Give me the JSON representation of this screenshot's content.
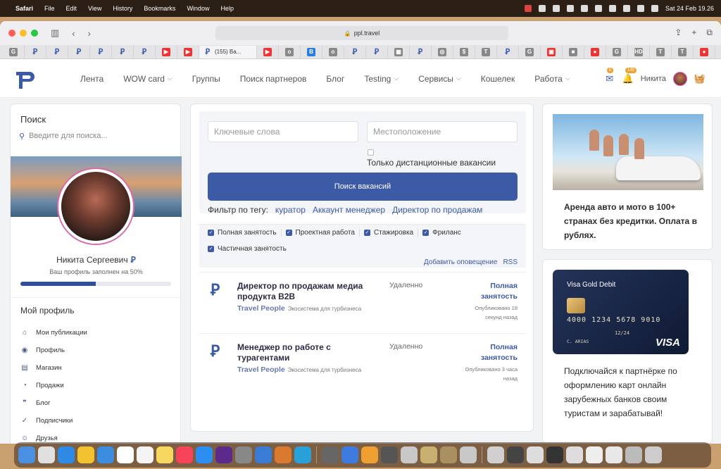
{
  "menubar": {
    "app": "Safari",
    "items": [
      "File",
      "Edit",
      "View",
      "History",
      "Bookmarks",
      "Window",
      "Help"
    ],
    "datetime": "Sat 24 Feb  19.26"
  },
  "browser": {
    "url": "ppl.travel",
    "active_tab": "(155) Ва..."
  },
  "site": {
    "nav": [
      {
        "label": "Лента",
        "dropdown": false
      },
      {
        "label": "WOW card",
        "dropdown": true
      },
      {
        "label": "Группы",
        "dropdown": false
      },
      {
        "label": "Поиск партнеров",
        "dropdown": false
      },
      {
        "label": "Блог",
        "dropdown": false
      },
      {
        "label": "Testing",
        "dropdown": true
      },
      {
        "label": "Сервисы",
        "dropdown": true
      },
      {
        "label": "Кошелек",
        "dropdown": false
      },
      {
        "label": "Работа",
        "dropdown": true
      }
    ],
    "messages_count": "6",
    "notifications_count": "149",
    "user_name": "Никита"
  },
  "sidebar": {
    "search_title": "Поиск",
    "search_placeholder": "Введите для поиска...",
    "full_name": "Никита Сергеевич",
    "profile_fill_text": "Ваш профиль заполнен на 50%",
    "profile_fill_percent": 50,
    "my_profile_title": "Мой профиль",
    "menu": [
      {
        "label": "Мои публикации",
        "icon": "home-icon"
      },
      {
        "label": "Профиль",
        "icon": "user-circle-icon"
      },
      {
        "label": "Магазин",
        "icon": "store-icon"
      },
      {
        "label": "Продажи",
        "icon": "gauge-icon"
      },
      {
        "label": "Блог",
        "icon": "quote-icon"
      },
      {
        "label": "Подписчики",
        "icon": "user-check-icon"
      },
      {
        "label": "Друзья",
        "icon": "users-icon"
      }
    ]
  },
  "jobs": {
    "keywords_placeholder": "Ключевые слова",
    "location_placeholder": "Местоположение",
    "remote_label": "Только дистанционные вакансии",
    "search_button": "Поиск вакансий",
    "tag_filter_label": "Фильтр по тегу:",
    "tags": [
      "куратор",
      "Аккаунт менеджер",
      "Директор по продажам"
    ],
    "types": [
      "Полная занятость",
      "Проектная работа",
      "Стажировка",
      "Фриланс",
      "Частичная занятость"
    ],
    "add_alert": "Добавить оповещение",
    "rss": "RSS",
    "listings": [
      {
        "title": "Директор по продажам медиа продукта B2B",
        "company": "Travel People",
        "company_desc": "Экосистема для турбизнеса",
        "location": "Удаленно",
        "type": "Полная занятость",
        "posted": "Опубликовано 18 секунд назад"
      },
      {
        "title": "Менеджер по работе с турагентами",
        "company": "Travel People",
        "company_desc": "Экосистема для турбизнеса",
        "location": "Удаленно",
        "type": "Полная занятость",
        "posted": "Опубликовано 3 часа назад"
      }
    ]
  },
  "ads": {
    "car_text": "Аренда авто и мото в 100+ странах без кредитки. Оплата в рублях.",
    "card_title": "Visa Gold Debit",
    "card_number": "4000 1234 5678 9010",
    "card_expiry": "12/24",
    "card_holder": "C. ARIAS",
    "card_brand": "VISA",
    "card_text": "Подключайся к партнёрке по оформлению карт онлайн зарубежных банков своим туристам и зарабатывай!"
  }
}
